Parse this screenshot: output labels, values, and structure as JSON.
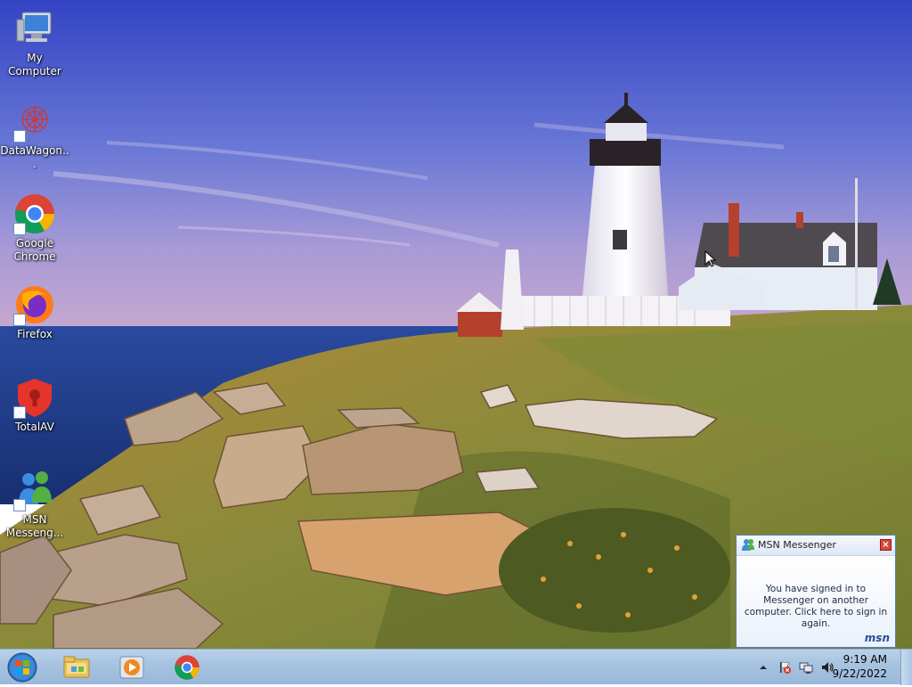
{
  "desktop": {
    "icons": [
      {
        "label": "My Computer",
        "icon": "computer-icon",
        "shortcut": false
      },
      {
        "label": "DataWagon...",
        "icon": "datawagon-icon",
        "shortcut": true
      },
      {
        "label": "Google Chrome",
        "icon": "chrome-icon",
        "shortcut": true
      },
      {
        "label": "Firefox",
        "icon": "firefox-icon",
        "shortcut": true
      },
      {
        "label": "TotalAV",
        "icon": "totalav-icon",
        "shortcut": true
      },
      {
        "label": "MSN Messeng...",
        "icon": "msn-messenger-icon",
        "shortcut": true
      }
    ]
  },
  "taskbar": {
    "start_icon": "windows-start-icon",
    "pinned": [
      {
        "icon": "file-explorer-icon"
      },
      {
        "icon": "media-player-icon"
      },
      {
        "icon": "chrome-icon"
      }
    ],
    "tray": {
      "time": "9:19 AM",
      "date": "9/22/2022",
      "icons": [
        "show-hidden-icons-arrow",
        "action-center-flag-icon",
        "network-icon",
        "volume-icon"
      ]
    }
  },
  "notification": {
    "title": "MSN Messenger",
    "message": "You have signed in to Messenger on another computer. Click here to sign in again.",
    "brand": "msn"
  },
  "colors": {
    "taskbar": "#a6c2e0",
    "sky_top": "#3b4fc4",
    "sea": "#1e3f8a"
  }
}
